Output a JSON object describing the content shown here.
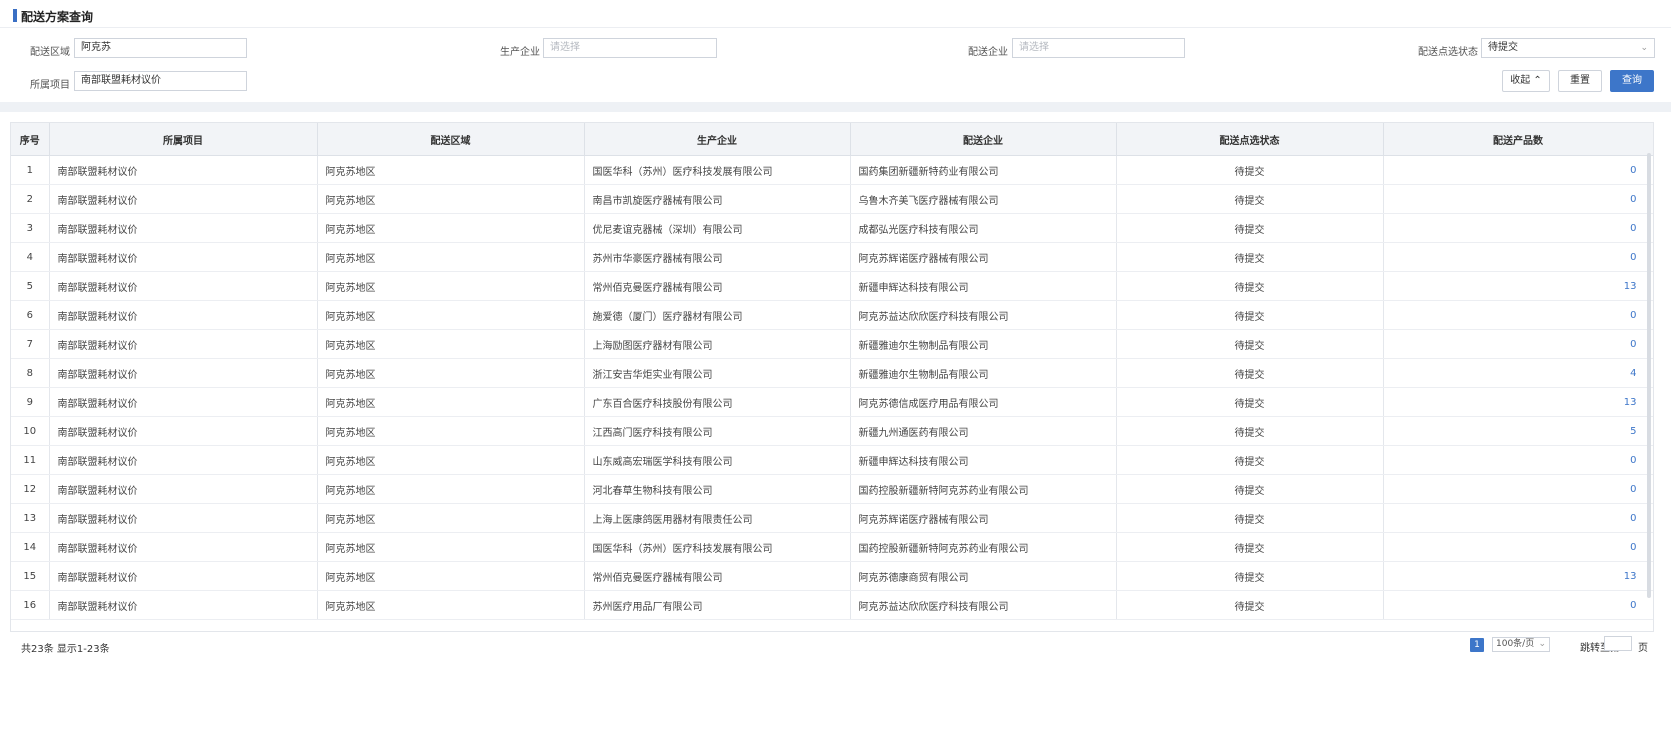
{
  "header": {
    "title": "配送方案查询"
  },
  "filters": {
    "region_label": "配送区域",
    "region_value": "阿克苏",
    "manufacturer_label": "生产企业",
    "manufacturer_placeholder": "请选择",
    "distributor_label": "配送企业",
    "distributor_placeholder": "请选择",
    "status_label": "配送点选状态",
    "status_value": "待提交",
    "project_label": "所属项目",
    "project_value": "南部联盟耗材议价"
  },
  "actions": {
    "collapse": "收起",
    "reset": "重置",
    "query": "查询"
  },
  "table": {
    "columns": [
      "序号",
      "所属项目",
      "配送区域",
      "生产企业",
      "配送企业",
      "配送点选状态",
      "配送产品数"
    ],
    "rows": [
      [
        "1",
        "南部联盟耗材议价",
        "阿克苏地区",
        "国医华科（苏州）医疗科技发展有限公司",
        "国药集团新疆新特药业有限公司",
        "待提交",
        "0"
      ],
      [
        "2",
        "南部联盟耗材议价",
        "阿克苏地区",
        "南昌市凯旋医疗器械有限公司",
        "乌鲁木齐美飞医疗器械有限公司",
        "待提交",
        "0"
      ],
      [
        "3",
        "南部联盟耗材议价",
        "阿克苏地区",
        "优尼麦谊克器械（深圳）有限公司",
        "成都弘光医疗科技有限公司",
        "待提交",
        "0"
      ],
      [
        "4",
        "南部联盟耗材议价",
        "阿克苏地区",
        "苏州市华豪医疗器械有限公司",
        "阿克苏辉诺医疗器械有限公司",
        "待提交",
        "0"
      ],
      [
        "5",
        "南部联盟耗材议价",
        "阿克苏地区",
        "常州佰克曼医疗器械有限公司",
        "新疆申辉达科技有限公司",
        "待提交",
        "13"
      ],
      [
        "6",
        "南部联盟耗材议价",
        "阿克苏地区",
        "施爱德（厦门）医疗器材有限公司",
        "阿克苏益达欣欣医疗科技有限公司",
        "待提交",
        "0"
      ],
      [
        "7",
        "南部联盟耗材议价",
        "阿克苏地区",
        "上海励图医疗器材有限公司",
        "新疆雅迪尔生物制品有限公司",
        "待提交",
        "0"
      ],
      [
        "8",
        "南部联盟耗材议价",
        "阿克苏地区",
        "浙江安吉华炬实业有限公司",
        "新疆雅迪尔生物制品有限公司",
        "待提交",
        "4"
      ],
      [
        "9",
        "南部联盟耗材议价",
        "阿克苏地区",
        "广东百合医疗科技股份有限公司",
        "阿克苏德信成医疗用品有限公司",
        "待提交",
        "13"
      ],
      [
        "10",
        "南部联盟耗材议价",
        "阿克苏地区",
        "江西高门医疗科技有限公司",
        "新疆九州通医药有限公司",
        "待提交",
        "5"
      ],
      [
        "11",
        "南部联盟耗材议价",
        "阿克苏地区",
        "山东威高宏瑞医学科技有限公司",
        "新疆申辉达科技有限公司",
        "待提交",
        "0"
      ],
      [
        "12",
        "南部联盟耗材议价",
        "阿克苏地区",
        "河北春草生物科技有限公司",
        "国药控股新疆新特阿克苏药业有限公司",
        "待提交",
        "0"
      ],
      [
        "13",
        "南部联盟耗材议价",
        "阿克苏地区",
        "上海上医康鸽医用器材有限责任公司",
        "阿克苏辉诺医疗器械有限公司",
        "待提交",
        "0"
      ],
      [
        "14",
        "南部联盟耗材议价",
        "阿克苏地区",
        "国医华科（苏州）医疗科技发展有限公司",
        "国药控股新疆新特阿克苏药业有限公司",
        "待提交",
        "0"
      ],
      [
        "15",
        "南部联盟耗材议价",
        "阿克苏地区",
        "常州佰克曼医疗器械有限公司",
        "阿克苏德康商贸有限公司",
        "待提交",
        "13"
      ],
      [
        "16",
        "南部联盟耗材议价",
        "阿克苏地区",
        "苏州医疗用品厂有限公司",
        "阿克苏益达欣欣医疗科技有限公司",
        "待提交",
        "0"
      ]
    ]
  },
  "footer": {
    "summary": "共23条 显示1-23条",
    "current_page": "1",
    "page_size": "100条/页",
    "jump_label": "跳转至第",
    "page_suffix": "页"
  },
  "icons": {
    "collapse": "chevron-up-icon",
    "select": "chevron-down-icon"
  },
  "colors": {
    "accent": "#3d76c9"
  }
}
